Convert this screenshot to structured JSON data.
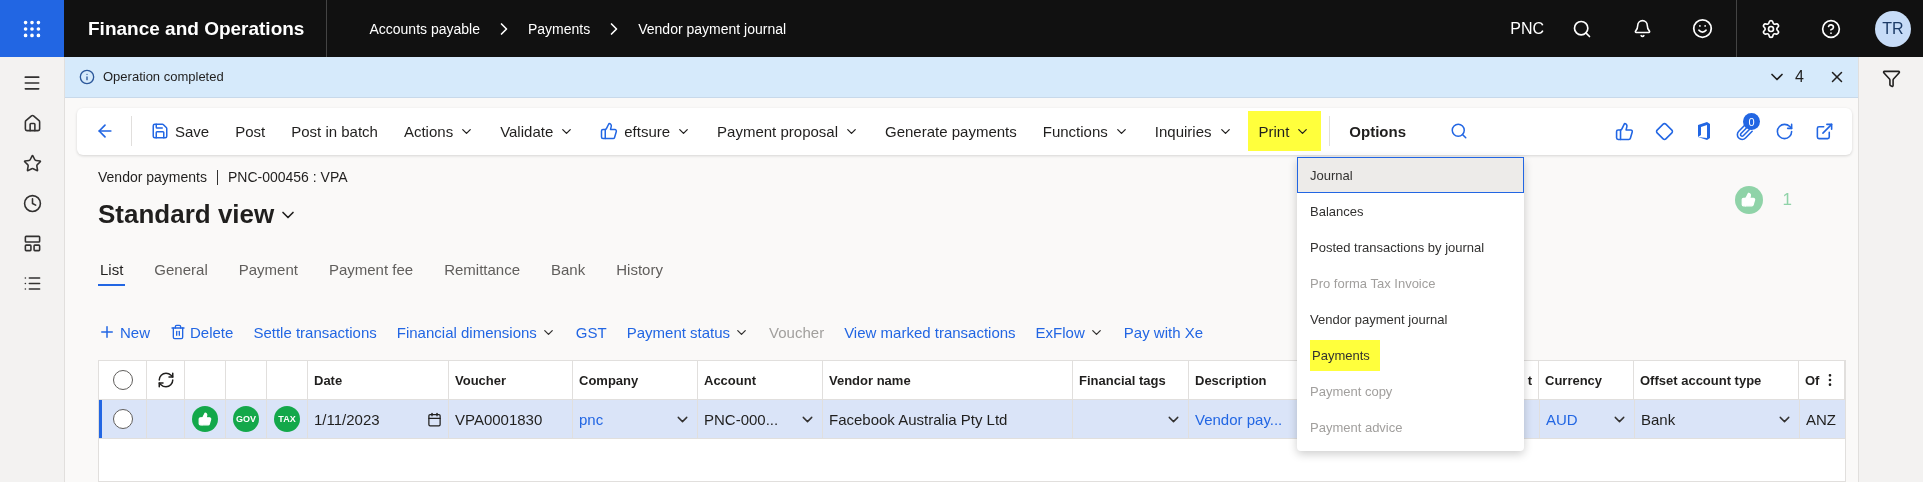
{
  "app": {
    "title": "Finance and Operations"
  },
  "breadcrumb": [
    "Accounts payable",
    "Payments",
    "Vendor payment journal"
  ],
  "top_bar": {
    "company": "PNC",
    "user_initials": "TR"
  },
  "notification": {
    "message": "Operation completed",
    "count": "4"
  },
  "action_pane": {
    "items": [
      {
        "label": "Save",
        "kind": "save",
        "highlighted": false
      },
      {
        "label": "Post",
        "kind": "plain",
        "highlighted": false
      },
      {
        "label": "Post in batch",
        "kind": "plain",
        "highlighted": false
      },
      {
        "label": "Actions",
        "kind": "menu",
        "highlighted": false
      },
      {
        "label": "Validate",
        "kind": "menu",
        "highlighted": false
      },
      {
        "label": "eftsure",
        "kind": "thumb_menu",
        "highlighted": false
      },
      {
        "label": "Payment proposal",
        "kind": "menu",
        "highlighted": false
      },
      {
        "label": "Generate payments",
        "kind": "plain",
        "highlighted": false
      },
      {
        "label": "Functions",
        "kind": "menu",
        "highlighted": false
      },
      {
        "label": "Inquiries",
        "kind": "menu",
        "highlighted": false
      },
      {
        "label": "Print",
        "kind": "menu",
        "highlighted": true
      },
      {
        "label": "Options",
        "kind": "bold",
        "highlighted": false
      }
    ],
    "attachment_count": "0"
  },
  "print_menu": {
    "items": [
      {
        "label": "Journal",
        "selected": true,
        "disabled": false,
        "highlighted": false
      },
      {
        "label": "Balances",
        "selected": false,
        "disabled": false,
        "highlighted": false
      },
      {
        "label": "Posted transactions by journal",
        "selected": false,
        "disabled": false,
        "highlighted": false
      },
      {
        "label": "Pro forma Tax Invoice",
        "selected": false,
        "disabled": true,
        "highlighted": false
      },
      {
        "label": "Vendor payment journal",
        "selected": false,
        "disabled": false,
        "highlighted": false
      },
      {
        "label": "Payments",
        "selected": false,
        "disabled": false,
        "highlighted": true
      },
      {
        "label": "Payment copy",
        "selected": false,
        "disabled": true,
        "highlighted": false
      },
      {
        "label": "Payment advice",
        "selected": false,
        "disabled": true,
        "highlighted": false
      }
    ]
  },
  "page": {
    "caption": "Vendor payments",
    "record": "PNC-000456 : VPA",
    "view": "Standard view",
    "likes": "1"
  },
  "tabs": [
    {
      "label": "List",
      "selected": true
    },
    {
      "label": "General",
      "selected": false
    },
    {
      "label": "Payment",
      "selected": false
    },
    {
      "label": "Payment fee",
      "selected": false
    },
    {
      "label": "Remittance",
      "selected": false
    },
    {
      "label": "Bank",
      "selected": false
    },
    {
      "label": "History",
      "selected": false
    }
  ],
  "grid_toolbar": [
    {
      "label": "New",
      "kind": "new",
      "disabled": false
    },
    {
      "label": "Delete",
      "kind": "delete",
      "disabled": false
    },
    {
      "label": "Settle transactions",
      "kind": "plain",
      "disabled": false
    },
    {
      "label": "Financial dimensions",
      "kind": "menu",
      "disabled": false
    },
    {
      "label": "GST",
      "kind": "plain",
      "disabled": false
    },
    {
      "label": "Payment status",
      "kind": "menu",
      "disabled": false
    },
    {
      "label": "Voucher",
      "kind": "plain",
      "disabled": true
    },
    {
      "label": "View marked transactions",
      "kind": "plain",
      "disabled": false
    },
    {
      "label": "ExFlow",
      "kind": "menu",
      "disabled": false
    },
    {
      "label": "Pay with Xe",
      "kind": "plain",
      "disabled": false
    }
  ],
  "grid": {
    "all_selected": false,
    "columns": [
      "Date",
      "Voucher",
      "Company",
      "Account",
      "Vendor name",
      "Financial tags",
      "Description",
      "t",
      "Currency",
      "Offset account type",
      "Of"
    ],
    "rows": [
      {
        "selected": true,
        "badges": [
          "GOV",
          "TAX"
        ],
        "cells": [
          {
            "kind": "date",
            "text": "1/11/2023"
          },
          {
            "kind": "text",
            "text": "VPA0001830"
          },
          {
            "kind": "link_select",
            "text": "pnc"
          },
          {
            "kind": "select",
            "text": "PNC-000..."
          },
          {
            "kind": "text",
            "text": "Facebook Australia Pty Ltd"
          },
          {
            "kind": "select"
          },
          {
            "kind": "link",
            "text": "Vendor pay..."
          },
          {
            "kind": "empty"
          },
          {
            "kind": "link_select",
            "text": "AUD"
          },
          {
            "kind": "select",
            "text": "Bank"
          },
          {
            "kind": "text",
            "text": "ANZ"
          }
        ]
      }
    ]
  }
}
